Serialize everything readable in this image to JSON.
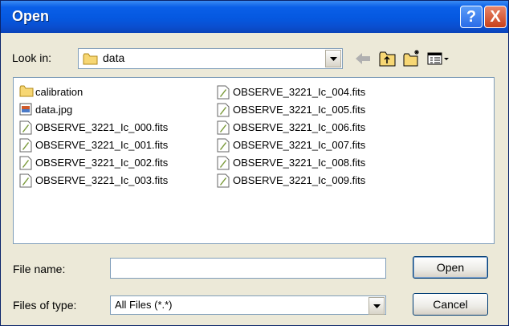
{
  "window": {
    "title": "Open",
    "help_glyph": "?",
    "close_glyph": "X"
  },
  "toolbar": {
    "look_in_label": "Look in:",
    "look_in_value": "data",
    "icons": [
      "back-arrow-icon",
      "up-folder-icon",
      "new-folder-icon",
      "view-menu-icon"
    ]
  },
  "files": {
    "column1": [
      {
        "name": "calibration",
        "icon": "folder-icon"
      },
      {
        "name": "data.jpg",
        "icon": "image-file-icon"
      },
      {
        "name": "OBSERVE_3221_Ic_000.fits",
        "icon": "document-icon"
      },
      {
        "name": "OBSERVE_3221_Ic_001.fits",
        "icon": "document-icon"
      },
      {
        "name": "OBSERVE_3221_Ic_002.fits",
        "icon": "document-icon"
      },
      {
        "name": "OBSERVE_3221_Ic_003.fits",
        "icon": "document-icon"
      }
    ],
    "column2": [
      {
        "name": "OBSERVE_3221_Ic_004.fits",
        "icon": "document-icon"
      },
      {
        "name": "OBSERVE_3221_Ic_005.fits",
        "icon": "document-icon"
      },
      {
        "name": "OBSERVE_3221_Ic_006.fits",
        "icon": "document-icon"
      },
      {
        "name": "OBSERVE_3221_Ic_007.fits",
        "icon": "document-icon"
      },
      {
        "name": "OBSERVE_3221_Ic_008.fits",
        "icon": "document-icon"
      },
      {
        "name": "OBSERVE_3221_Ic_009.fits",
        "icon": "document-icon"
      }
    ]
  },
  "form": {
    "file_name_label": "File name:",
    "file_name_value": "",
    "file_type_label": "Files of type:",
    "file_type_value": "All Files (*.*)"
  },
  "buttons": {
    "open": "Open",
    "cancel": "Cancel"
  }
}
